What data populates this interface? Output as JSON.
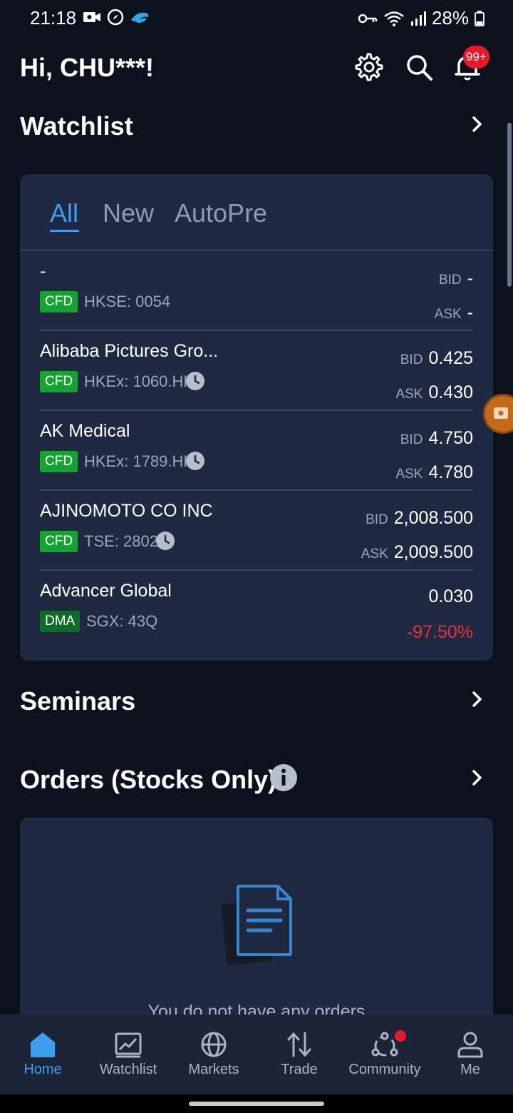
{
  "status_bar": {
    "time": "21:18",
    "battery": "28%"
  },
  "header": {
    "greeting": "Hi, CHU***!",
    "notification_badge": "99+"
  },
  "watchlist": {
    "title": "Watchlist",
    "tabs": [
      "All",
      "New",
      "AutoPre"
    ],
    "active_tab": "All",
    "items": [
      {
        "name": "-",
        "badge": "CFD",
        "exchange": "HKSE: 0054",
        "bid_label": "BID",
        "bid": "-",
        "ask_label": "ASK",
        "ask": "-"
      },
      {
        "name": "Alibaba Pictures Gro...",
        "badge": "CFD",
        "exchange": "HKEx: 1060.HK",
        "bid_label": "BID",
        "bid": "0.425",
        "ask_label": "ASK",
        "ask": "0.430"
      },
      {
        "name": "AK Medical",
        "badge": "CFD",
        "exchange": "HKEx: 1789.HK",
        "bid_label": "BID",
        "bid": "4.750",
        "ask_label": "ASK",
        "ask": "4.780"
      },
      {
        "name": "AJINOMOTO CO INC",
        "badge": "CFD",
        "exchange": "TSE: 2802",
        "bid_label": "BID",
        "bid": "2,008.500",
        "ask_label": "ASK",
        "ask": "2,009.500"
      },
      {
        "name": "Advancer Global",
        "badge": "DMA",
        "exchange": "SGX: 43Q",
        "price": "0.030",
        "change": "-97.50%"
      }
    ]
  },
  "seminars": {
    "title": "Seminars"
  },
  "orders": {
    "title": "Orders (Stocks Only)",
    "empty_text": "You do not have any orders"
  },
  "bottom_nav": {
    "items": [
      {
        "label": "Home",
        "icon": "home-icon",
        "active": true
      },
      {
        "label": "Watchlist",
        "icon": "chart-icon"
      },
      {
        "label": "Markets",
        "icon": "globe-icon"
      },
      {
        "label": "Trade",
        "icon": "trade-arrows-icon"
      },
      {
        "label": "Community",
        "icon": "community-icon",
        "has_dot": true
      },
      {
        "label": "Me",
        "icon": "person-icon"
      }
    ]
  },
  "colors": {
    "background": "#0b111d",
    "card": "#1f2941",
    "accent": "#3d9ef0",
    "cfd_badge": "#17a332",
    "dma_badge": "#0f6b2a",
    "negative": "#e8323c",
    "notification": "#e8192b"
  }
}
